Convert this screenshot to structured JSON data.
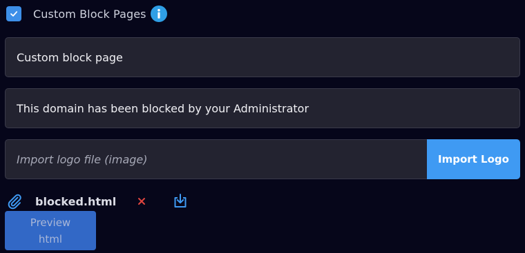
{
  "header": {
    "title": "Custom Block Pages",
    "checked": true
  },
  "fields": {
    "title_value": "Custom block page",
    "message_value": "This domain has been blocked by your Administrator"
  },
  "logo": {
    "placeholder": "Import logo file (image)",
    "button_label": "Import Logo"
  },
  "file": {
    "name": "blocked.html"
  },
  "preview": {
    "label": "Preview html"
  },
  "colors": {
    "accent": "#3f9af3",
    "remove": "#e0453f",
    "background": "#06061a"
  },
  "icons": {
    "checkbox": "check-icon",
    "info": "info-icon",
    "attach": "paperclip-icon",
    "remove": "close-icon",
    "download": "download-icon"
  }
}
